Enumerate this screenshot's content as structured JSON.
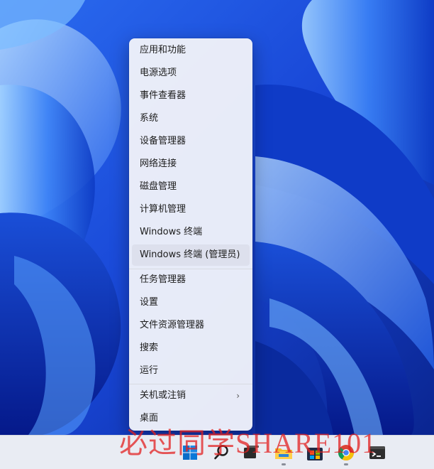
{
  "menu": {
    "items": [
      {
        "label": "应用和功能"
      },
      {
        "label": "电源选项"
      },
      {
        "label": "事件查看器"
      },
      {
        "label": "系统"
      },
      {
        "label": "设备管理器"
      },
      {
        "label": "网络连接"
      },
      {
        "label": "磁盘管理"
      },
      {
        "label": "计算机管理"
      },
      {
        "label": "Windows 终端"
      },
      {
        "label": "Windows 终端 (管理员)",
        "highlighted": true
      },
      {
        "label": "任务管理器"
      },
      {
        "label": "设置"
      },
      {
        "label": "文件资源管理器"
      },
      {
        "label": "搜索"
      },
      {
        "label": "运行"
      },
      {
        "label": "关机或注销",
        "has_submenu": true
      },
      {
        "label": "桌面"
      }
    ]
  },
  "taskbar": {
    "icons": [
      {
        "name": "start-icon"
      },
      {
        "name": "search-icon"
      },
      {
        "name": "task-view-icon"
      },
      {
        "name": "file-explorer-icon"
      },
      {
        "name": "store-icon"
      },
      {
        "name": "chrome-icon"
      },
      {
        "name": "terminal-icon"
      }
    ]
  },
  "watermark": {
    "text": "必过同学SHARE101"
  },
  "colors": {
    "accent": "#0067c0",
    "wallpaper_deep": "#0a2d9a",
    "wallpaper_light": "#6fb2ff"
  }
}
